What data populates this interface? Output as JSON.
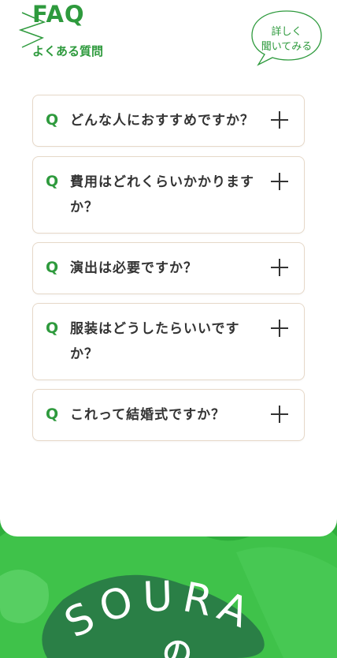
{
  "header": {
    "title": "FAQ",
    "subtitle": "よくある質問",
    "ask_button": {
      "line1": "詳しく",
      "line2": "聞いてみる"
    }
  },
  "faq": {
    "q_marker": "Q",
    "items": [
      {
        "question": "どんな人におすすめですか？"
      },
      {
        "question": "費用はどれくらいかかりますか？"
      },
      {
        "question": "演出は必要ですか？"
      },
      {
        "question": "服装はどうしたらいいですか？"
      },
      {
        "question": "これって結婚式ですか？"
      }
    ]
  },
  "footer": {
    "brand_text": "SOURA",
    "sub_glyph": "の"
  },
  "colors": {
    "accent": "#2e9a3d",
    "footer_green": "#2fae3c",
    "card_border": "#e6d8c8",
    "text": "#333333"
  },
  "icons": [
    "plus-icon",
    "speech-bubble-icon"
  ]
}
